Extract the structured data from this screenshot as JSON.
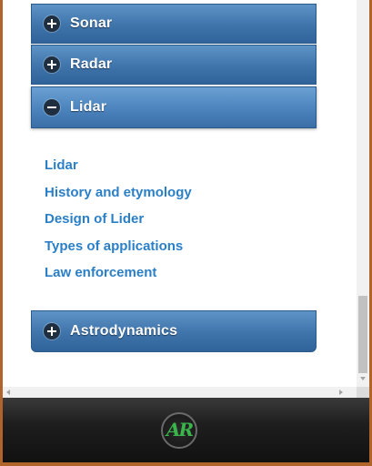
{
  "accordion": [
    {
      "label": "Sonar",
      "state": "collapsed",
      "icon": "plus-icon"
    },
    {
      "label": "Radar",
      "state": "collapsed",
      "icon": "plus-icon"
    },
    {
      "label": "Lidar",
      "state": "expanded",
      "icon": "minus-icon",
      "links": [
        "Lidar",
        "History and etymology",
        "Design of Lider",
        "Types of applications",
        "Law enforcement"
      ]
    },
    {
      "label": "Astrodynamics",
      "state": "collapsed",
      "icon": "plus-icon"
    }
  ],
  "footer": {
    "logo_text": "AR"
  },
  "colors": {
    "accent": "#4178b1",
    "link": "#2a7fc7",
    "frame": "#b0642a"
  }
}
